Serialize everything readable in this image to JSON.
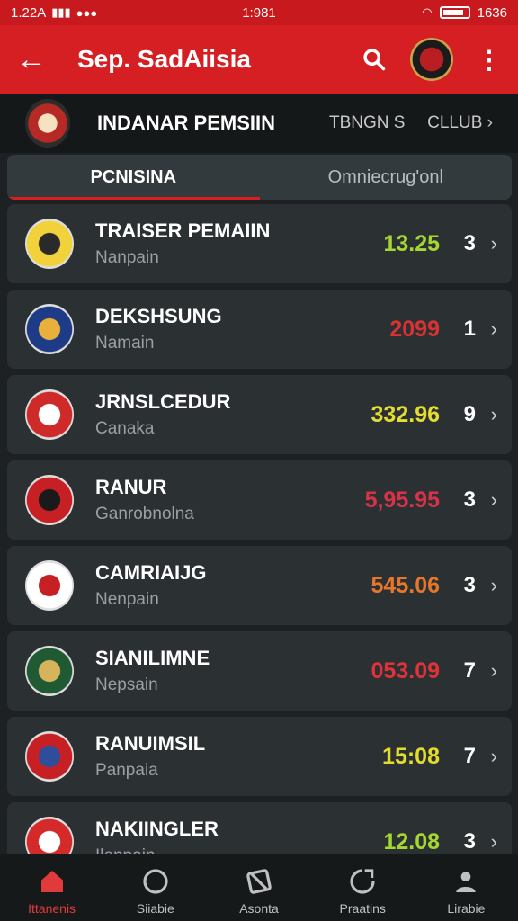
{
  "status_bar": {
    "time_left": "1.22A",
    "time_center": "1:981",
    "battery_level": "1636"
  },
  "header": {
    "title": "Sep. SadAiisia"
  },
  "subnav": {
    "title": "INDANAR PEMSIIN",
    "link": "TBNGN S",
    "club_link": "CLLUB",
    "chevron": "›"
  },
  "tabs": [
    {
      "label": "PCNISINA"
    },
    {
      "label": "Omniecrug'onl"
    }
  ],
  "rows": [
    {
      "title": "TRAISER PEMAIIN",
      "subtitle": "Nanpain",
      "value": "13.25",
      "value_color": "#a6d632",
      "count": "3",
      "logo_colors": [
        "#f1d23b",
        "#2a2a2a"
      ]
    },
    {
      "title": "DEKSHSUNG",
      "subtitle": "Namain",
      "value": "2099",
      "value_color": "#d83232",
      "count": "1",
      "logo_colors": [
        "#1d3b86",
        "#e9b13c"
      ]
    },
    {
      "title": "JRNSLCEDUR",
      "subtitle": "Canaka",
      "value": "332.96",
      "value_color": "#e2dc34",
      "count": "9",
      "logo_colors": [
        "#cf2a2a",
        "#ffffff"
      ]
    },
    {
      "title": "RANUR",
      "subtitle": "Ganrobnolna",
      "value": "5,95.95",
      "value_color": "#d83248",
      "count": "3",
      "logo_colors": [
        "#c61f24",
        "#1a1a1a"
      ]
    },
    {
      "title": "CAMRIAIJG",
      "subtitle": "Nenpain",
      "value": "545.06",
      "value_color": "#e6762c",
      "count": "3",
      "logo_colors": [
        "#ffffff",
        "#c61f24"
      ]
    },
    {
      "title": "SIANILIMNE",
      "subtitle": "Nepsain",
      "value": "053.09",
      "value_color": "#e0323a",
      "count": "7",
      "logo_colors": [
        "#1f5a33",
        "#d7b45c"
      ]
    },
    {
      "title": "RANUIMSIL",
      "subtitle": "Panpaia",
      "value": "15:08",
      "value_color": "#e4dc2a",
      "count": "7",
      "logo_colors": [
        "#c61f24",
        "#2e4e9c"
      ]
    },
    {
      "title": "NAKIINGLER",
      "subtitle": "Ilenpain",
      "value": "12.08",
      "value_color": "#a6d632",
      "count": "3",
      "logo_colors": [
        "#d42a2a",
        "#ffffff"
      ]
    }
  ],
  "row_chevron": "›",
  "bottom_nav": [
    {
      "label": "Ittanenis",
      "icon": "home-icon",
      "active": true
    },
    {
      "label": "Siiabie",
      "icon": "circle-icon",
      "active": false
    },
    {
      "label": "Asonta",
      "icon": "tag-icon",
      "active": false
    },
    {
      "label": "Praatins",
      "icon": "loop-icon",
      "active": false
    },
    {
      "label": "Lirabie",
      "icon": "profile-icon",
      "active": false
    }
  ],
  "colors": {
    "accent": "#d51f23",
    "background": "#1d2123",
    "card": "#2b3033"
  }
}
